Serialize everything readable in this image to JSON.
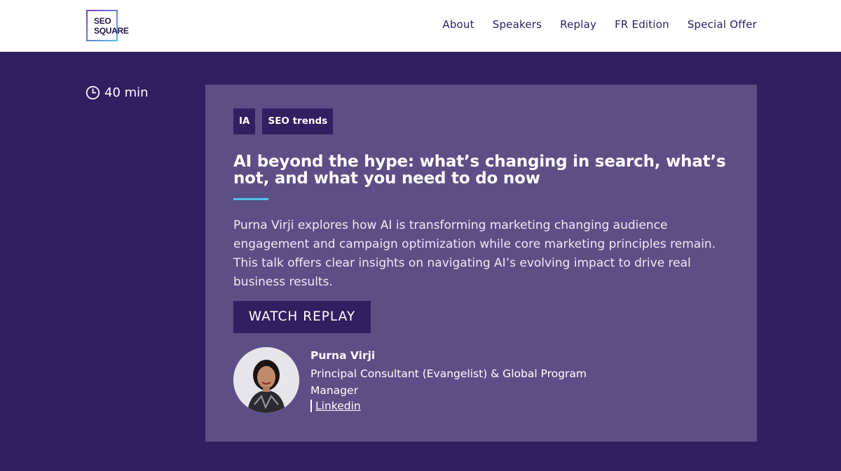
{
  "header": {
    "logo_line1": "SEO",
    "logo_line2": "SQUARE",
    "nav": [
      "About",
      "Speakers",
      "Replay",
      "FR Edition",
      "Special Offer"
    ]
  },
  "duration": {
    "icon": "clock-icon",
    "label": "40 min"
  },
  "talk": {
    "tags": [
      "IA",
      "SEO trends"
    ],
    "title": "AI beyond the hype: what’s changing in search, what’s not, and what you need to do now",
    "description": "Purna Virji explores how AI is transforming marketing changing audience engagement and campaign optimization while core marketing principles remain. This talk offers clear insights on navigating AI’s evolving impact to drive real business results.",
    "cta": "WATCH REPLAY"
  },
  "speaker": {
    "name": "Purna Virji",
    "role": "Principal Consultant (Evangelist) & Global Program Manager",
    "link": "Linkedin"
  },
  "colors": {
    "page_bg": "#2e2061",
    "card_bg": "#5c4f86",
    "accent": "#4fc3e6",
    "nav_text": "#2a1f5e"
  }
}
